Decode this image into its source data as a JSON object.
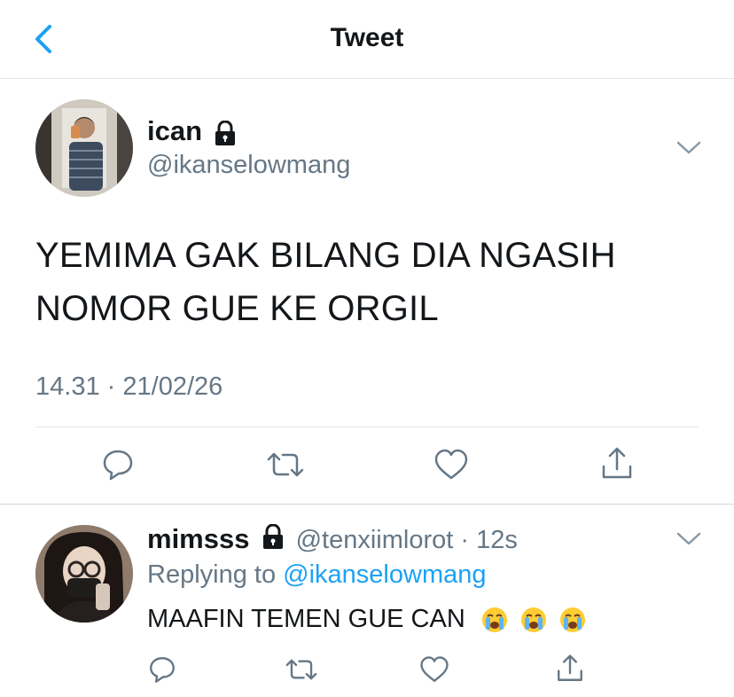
{
  "header": {
    "title": "Tweet",
    "back_icon": "chevron-left-icon"
  },
  "tweet": {
    "name": "ican",
    "handle": "@ikanselowmang",
    "text_line1": "YEMIMA GAK BILANG DIA NGASIH",
    "text_line2": "NOMOR GUE KE ORGIL",
    "time": "14.31",
    "separator": "·",
    "date": "21/02/26",
    "actions": [
      "comment-icon",
      "retweet-icon",
      "like-icon",
      "share-icon"
    ]
  },
  "reply": {
    "name": "mimsss",
    "handle": "@tenxiimlorot",
    "separator": "·",
    "age": "12s",
    "replying_prefix": "Replying to",
    "replying_handle": "@ikanselowmang",
    "text": "MAAFIN TEMEN GUE CAN",
    "emoji_count": 3,
    "emoji_name": "loudly-crying-face"
  },
  "colors": {
    "accent": "#1da1f2",
    "secondary": "#657786",
    "border": "#e1e8ed",
    "text": "#14171a"
  }
}
